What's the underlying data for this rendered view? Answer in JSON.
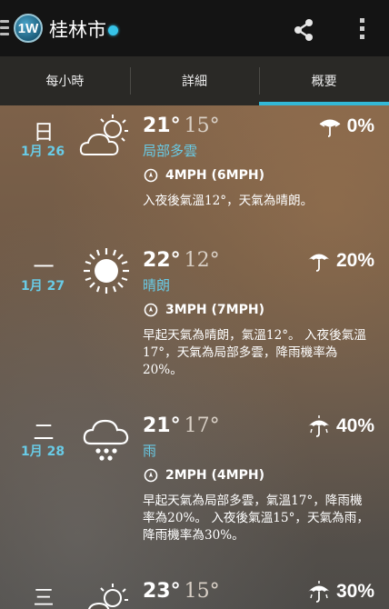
{
  "header": {
    "city": "桂林市",
    "logo_text": "1W",
    "accent_color": "#33b8d6"
  },
  "tabs": [
    {
      "label": "每小時",
      "active": false
    },
    {
      "label": "詳細",
      "active": false
    },
    {
      "label": "概要",
      "active": true
    }
  ],
  "days": [
    {
      "dow": "日",
      "date": "1月 26",
      "icon": "partly-cloudy-icon",
      "high": "21°",
      "low": "15°",
      "condition": "局部多雲",
      "wind": "4MPH (6MPH)",
      "description": "入夜後氣溫12°，天氣為晴朗。",
      "precip": "0%",
      "umbrella": "closed-umbrella-icon"
    },
    {
      "dow": "一",
      "date": "1月 27",
      "icon": "sunny-icon",
      "high": "22°",
      "low": "12°",
      "condition": "晴朗",
      "wind": "3MPH (7MPH)",
      "description": "早起天氣為晴朗，氣溫12°。 入夜後氣溫17°，天氣為局部多雲，降雨機率為20%。",
      "precip": "20%",
      "umbrella": "open-umbrella-icon"
    },
    {
      "dow": "二",
      "date": "1月 28",
      "icon": "rain-icon",
      "high": "21°",
      "low": "17°",
      "condition": "雨",
      "wind": "2MPH (4MPH)",
      "description": "早起天氣為局部多雲，氣溫17°，降雨機率為20%。 入夜後氣溫15°，天氣為雨，降雨機率為30%。",
      "precip": "40%",
      "umbrella": "rain-umbrella-icon"
    },
    {
      "dow": "三",
      "icon": "partly-cloudy-icon",
      "high": "23°",
      "low": "15°",
      "precip": "30%",
      "umbrella": "rain-umbrella-icon"
    }
  ]
}
